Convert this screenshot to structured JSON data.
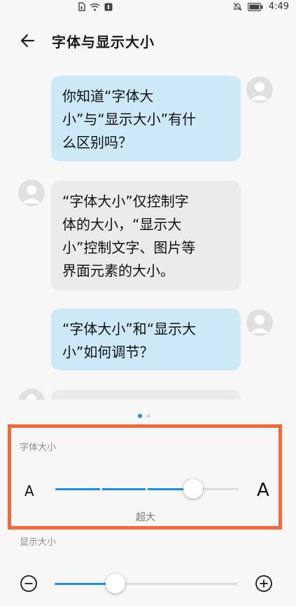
{
  "status_bar": {
    "time": "4:49"
  },
  "header": {
    "title": "字体与显示大小"
  },
  "chat": {
    "messages": [
      {
        "side": "right",
        "lines": [
          "你知道“字体大",
          "小”与“显示大小”有什",
          "么区别吗？"
        ]
      },
      {
        "side": "left",
        "lines": [
          "“字体大小”仅控制字",
          "体的大小，“显示大",
          "小”控制文字、图片等",
          "界面元素的大小。"
        ]
      },
      {
        "side": "right",
        "lines": [
          "“字体大小”和“显示大",
          "小”如何调节？"
        ]
      }
    ]
  },
  "font_size": {
    "label": "字体大小",
    "small_glyph": "A",
    "large_glyph": "A",
    "value_label": "超大",
    "level": 4,
    "levels": 5
  },
  "display_size": {
    "label": "显示大小",
    "level": 2,
    "levels": 4
  },
  "colors": {
    "accent": "#1a8de8",
    "highlight_border": "#f26a3b",
    "bubble_right": "#cde9f8",
    "bubble_left": "#ebebeb"
  }
}
